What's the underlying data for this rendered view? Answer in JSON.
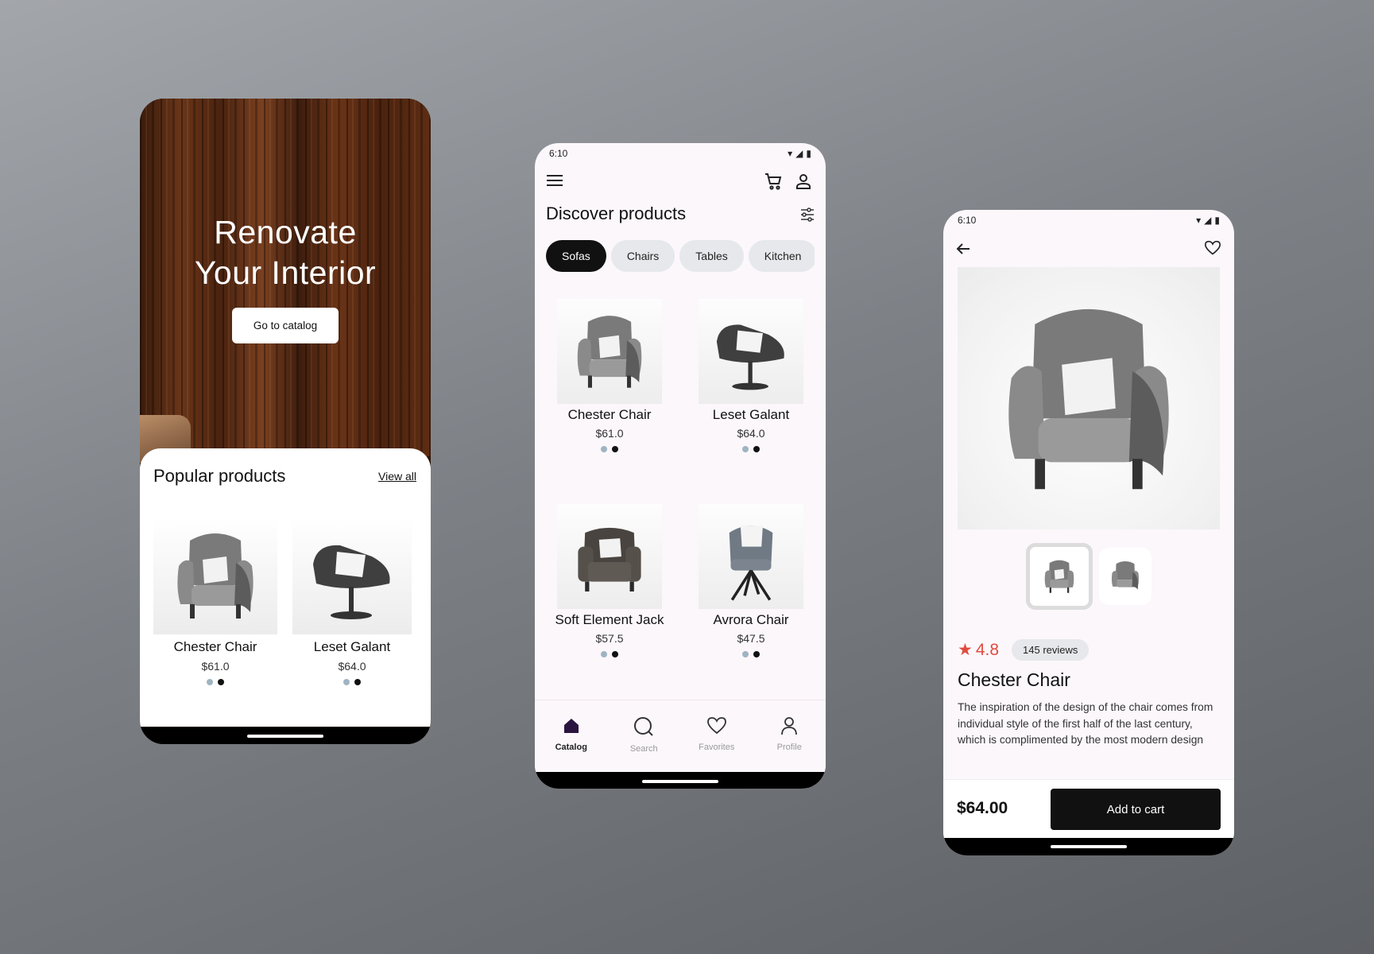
{
  "screen1": {
    "hero_title_line1": "Renovate",
    "hero_title_line2": "Your Interior",
    "cta_label": "Go to catalog",
    "section_title": "Popular products",
    "view_all_label": "View all",
    "products": [
      {
        "name": "Chester Chair",
        "price": "$61.0",
        "colors": [
          "#9fb4c2",
          "#111111"
        ]
      },
      {
        "name": "Leset Galant",
        "price": "$64.0",
        "colors": [
          "#9fb4c2",
          "#111111"
        ]
      }
    ]
  },
  "screen2": {
    "status_time": "6:10",
    "page_title": "Discover products",
    "categories": [
      {
        "label": "Sofas",
        "active": true
      },
      {
        "label": "Chairs",
        "active": false
      },
      {
        "label": "Tables",
        "active": false
      },
      {
        "label": "Kitchen",
        "active": false
      }
    ],
    "products": [
      {
        "name": "Chester Chair",
        "price": "$61.0",
        "colors": [
          "#9fb4c2",
          "#111111"
        ]
      },
      {
        "name": "Leset Galant",
        "price": "$64.0",
        "colors": [
          "#9fb4c2",
          "#111111"
        ]
      },
      {
        "name": "Soft Element Jack",
        "price": "$57.5",
        "colors": [
          "#9fb4c2",
          "#111111"
        ]
      },
      {
        "name": "Avrora Chair",
        "price": "$47.5",
        "colors": [
          "#9fb4c2",
          "#111111"
        ]
      }
    ],
    "bottom_nav": [
      {
        "label": "Catalog",
        "icon": "home-icon",
        "active": true
      },
      {
        "label": "Search",
        "icon": "search-icon",
        "active": false
      },
      {
        "label": "Favorites",
        "icon": "heart-icon",
        "active": false
      },
      {
        "label": "Profile",
        "icon": "person-icon",
        "active": false
      }
    ]
  },
  "screen3": {
    "status_time": "6:10",
    "rating": "4.8",
    "reviews": "145 reviews",
    "product_name": "Chester Chair",
    "description": "The inspiration of the design of the chair comes from individual style of the first half of the last century, which is complimented by the most modern design",
    "price": "$64.00",
    "add_to_cart_label": "Add to cart"
  },
  "colors": {
    "accent_dark": "#111111",
    "chip_bg": "#e6e8eb",
    "rating_red": "#e04a3f",
    "color_dot_blue": "#9fb4c2"
  }
}
